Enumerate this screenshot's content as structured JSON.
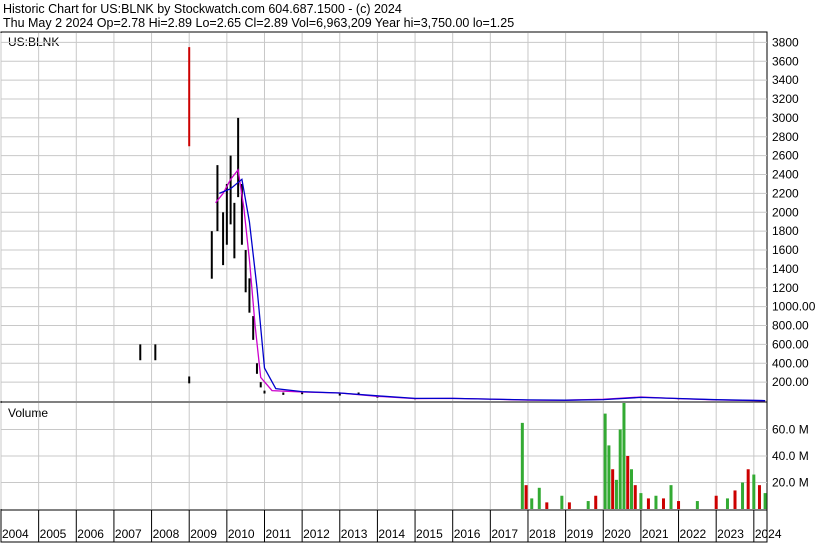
{
  "header": {
    "line1": "Historic Chart for US:BLNK by Stockwatch.com 604.687.1500 - (c) 2024",
    "line2": "Thu May  2 2024   Op=2.78   Hi=2.89   Lo=2.65   Cl=2.89   Vol=6,963,209   Year hi=3,750.00   lo=1.25"
  },
  "colors": {
    "price_bar": "#000000",
    "price_down": "#cc0000",
    "ma_short": "#cc00cc",
    "ma_long": "#0000cc",
    "volume_up": "#33aa33",
    "volume_down": "#cc0000",
    "grid": "#c8c8c8"
  },
  "chart_data": [
    {
      "type": "line",
      "panel": "price",
      "title": "US:BLNK",
      "y_scale": "linear",
      "ylim": [
        0,
        3900
      ],
      "y_ticks": [
        200,
        400,
        600,
        800,
        1000,
        1200,
        1400,
        1600,
        1800,
        2000,
        2200,
        2400,
        2600,
        2800,
        3000,
        3200,
        3400,
        3600,
        3800
      ],
      "y_tick_labels": [
        "200.00",
        "400.00",
        "600.00",
        "800.00",
        "1000.00",
        "1200",
        "1400",
        "1600",
        "1800",
        "2000",
        "2200",
        "2400",
        "2600",
        "2800",
        "3000",
        "3200",
        "3400",
        "3600",
        "3800"
      ],
      "grid": true,
      "series": [
        {
          "style": "hi-lo bars",
          "points": [
            {
              "x": 2009.0,
              "y": 3750
            },
            {
              "x": 2007.7,
              "y": 600
            },
            {
              "x": 2008.1,
              "y": 600
            },
            {
              "x": 2009.0,
              "y": 260
            },
            {
              "x": 2009.6,
              "y": 1800
            },
            {
              "x": 2009.75,
              "y": 2500
            },
            {
              "x": 2009.9,
              "y": 2000
            },
            {
              "x": 2010.0,
              "y": 2300
            },
            {
              "x": 2010.1,
              "y": 2600
            },
            {
              "x": 2010.2,
              "y": 2100
            },
            {
              "x": 2010.3,
              "y": 3000
            },
            {
              "x": 2010.4,
              "y": 2300
            },
            {
              "x": 2010.5,
              "y": 1600
            },
            {
              "x": 2010.6,
              "y": 1300
            },
            {
              "x": 2010.7,
              "y": 900
            },
            {
              "x": 2010.8,
              "y": 400
            },
            {
              "x": 2010.9,
              "y": 200
            },
            {
              "x": 2011.0,
              "y": 110
            },
            {
              "x": 2011.5,
              "y": 90
            },
            {
              "x": 2012.0,
              "y": 100
            },
            {
              "x": 2013.0,
              "y": 80
            },
            {
              "x": 2013.5,
              "y": 90
            },
            {
              "x": 2014.0,
              "y": 50
            },
            {
              "x": 2015.0,
              "y": 25
            },
            {
              "x": 2016.0,
              "y": 30
            },
            {
              "x": 2017.0,
              "y": 20
            },
            {
              "x": 2018.0,
              "y": 10
            },
            {
              "x": 2019.0,
              "y": 8
            },
            {
              "x": 2020.0,
              "y": 20
            },
            {
              "x": 2021.0,
              "y": 45
            },
            {
              "x": 2022.0,
              "y": 25
            },
            {
              "x": 2023.0,
              "y": 12
            },
            {
              "x": 2024.3,
              "y": 3
            }
          ]
        },
        {
          "style": "moving average (short)",
          "points": [
            {
              "x": 2009.7,
              "y": 2100
            },
            {
              "x": 2009.9,
              "y": 2200
            },
            {
              "x": 2010.1,
              "y": 2350
            },
            {
              "x": 2010.3,
              "y": 2450
            },
            {
              "x": 2010.45,
              "y": 2050
            },
            {
              "x": 2010.6,
              "y": 1500
            },
            {
              "x": 2010.75,
              "y": 800
            },
            {
              "x": 2010.9,
              "y": 250
            },
            {
              "x": 2011.2,
              "y": 110
            },
            {
              "x": 2012.0,
              "y": 95
            },
            {
              "x": 2013.0,
              "y": 85
            },
            {
              "x": 2014.0,
              "y": 50
            },
            {
              "x": 2015.0,
              "y": 25
            },
            {
              "x": 2016.0,
              "y": 28
            },
            {
              "x": 2017.0,
              "y": 20
            },
            {
              "x": 2018.0,
              "y": 10
            },
            {
              "x": 2019.0,
              "y": 8
            },
            {
              "x": 2020.0,
              "y": 18
            },
            {
              "x": 2021.0,
              "y": 42
            },
            {
              "x": 2022.0,
              "y": 25
            },
            {
              "x": 2023.0,
              "y": 12
            },
            {
              "x": 2024.3,
              "y": 3
            }
          ]
        },
        {
          "style": "moving average (long)",
          "points": [
            {
              "x": 2009.8,
              "y": 2200
            },
            {
              "x": 2010.1,
              "y": 2250
            },
            {
              "x": 2010.4,
              "y": 2350
            },
            {
              "x": 2010.6,
              "y": 1900
            },
            {
              "x": 2010.8,
              "y": 1200
            },
            {
              "x": 2011.0,
              "y": 350
            },
            {
              "x": 2011.3,
              "y": 130
            },
            {
              "x": 2012.0,
              "y": 100
            },
            {
              "x": 2013.0,
              "y": 85
            },
            {
              "x": 2014.0,
              "y": 55
            },
            {
              "x": 2015.0,
              "y": 28
            },
            {
              "x": 2016.0,
              "y": 28
            },
            {
              "x": 2017.0,
              "y": 20
            },
            {
              "x": 2018.0,
              "y": 12
            },
            {
              "x": 2019.0,
              "y": 8
            },
            {
              "x": 2020.0,
              "y": 15
            },
            {
              "x": 2021.0,
              "y": 38
            },
            {
              "x": 2022.0,
              "y": 27
            },
            {
              "x": 2023.0,
              "y": 14
            },
            {
              "x": 2024.3,
              "y": 4
            }
          ]
        }
      ]
    },
    {
      "type": "bar",
      "panel": "volume",
      "title": "Volume",
      "ylim": [
        0,
        80
      ],
      "y_ticks": [
        20,
        40,
        60
      ],
      "y_tick_labels": [
        "20.0 M",
        "40.0 M",
        "60.0 M"
      ],
      "grid": true,
      "bars": [
        {
          "x": 2017.85,
          "value": 65,
          "dir": "up"
        },
        {
          "x": 2017.95,
          "value": 18,
          "dir": "down"
        },
        {
          "x": 2018.1,
          "value": 8,
          "dir": "up"
        },
        {
          "x": 2018.3,
          "value": 16,
          "dir": "up"
        },
        {
          "x": 2018.5,
          "value": 5,
          "dir": "down"
        },
        {
          "x": 2018.9,
          "value": 10,
          "dir": "up"
        },
        {
          "x": 2019.1,
          "value": 5,
          "dir": "down"
        },
        {
          "x": 2019.6,
          "value": 6,
          "dir": "up"
        },
        {
          "x": 2019.8,
          "value": 10,
          "dir": "down"
        },
        {
          "x": 2020.05,
          "value": 72,
          "dir": "up"
        },
        {
          "x": 2020.15,
          "value": 48,
          "dir": "up"
        },
        {
          "x": 2020.25,
          "value": 30,
          "dir": "down"
        },
        {
          "x": 2020.35,
          "value": 22,
          "dir": "up"
        },
        {
          "x": 2020.45,
          "value": 60,
          "dir": "up"
        },
        {
          "x": 2020.55,
          "value": 83,
          "dir": "up"
        },
        {
          "x": 2020.65,
          "value": 40,
          "dir": "down"
        },
        {
          "x": 2020.75,
          "value": 30,
          "dir": "up"
        },
        {
          "x": 2020.85,
          "value": 18,
          "dir": "down"
        },
        {
          "x": 2021.0,
          "value": 12,
          "dir": "up"
        },
        {
          "x": 2021.2,
          "value": 8,
          "dir": "down"
        },
        {
          "x": 2021.4,
          "value": 10,
          "dir": "up"
        },
        {
          "x": 2021.6,
          "value": 8,
          "dir": "down"
        },
        {
          "x": 2021.8,
          "value": 18,
          "dir": "up"
        },
        {
          "x": 2022.0,
          "value": 6,
          "dir": "down"
        },
        {
          "x": 2022.5,
          "value": 6,
          "dir": "up"
        },
        {
          "x": 2023.0,
          "value": 10,
          "dir": "down"
        },
        {
          "x": 2023.3,
          "value": 8,
          "dir": "up"
        },
        {
          "x": 2023.5,
          "value": 14,
          "dir": "down"
        },
        {
          "x": 2023.7,
          "value": 20,
          "dir": "up"
        },
        {
          "x": 2023.85,
          "value": 30,
          "dir": "down"
        },
        {
          "x": 2024.0,
          "value": 26,
          "dir": "up"
        },
        {
          "x": 2024.15,
          "value": 18,
          "dir": "down"
        },
        {
          "x": 2024.3,
          "value": 12,
          "dir": "up"
        }
      ]
    }
  ],
  "x_axis": {
    "type": "time",
    "years": [
      "2004",
      "2005",
      "2006",
      "2007",
      "2008",
      "2009",
      "2010",
      "2011",
      "2012",
      "2013",
      "2014",
      "2015",
      "2016",
      "2017",
      "2018",
      "2019",
      "2020",
      "2021",
      "2022",
      "2023",
      "2024"
    ]
  }
}
